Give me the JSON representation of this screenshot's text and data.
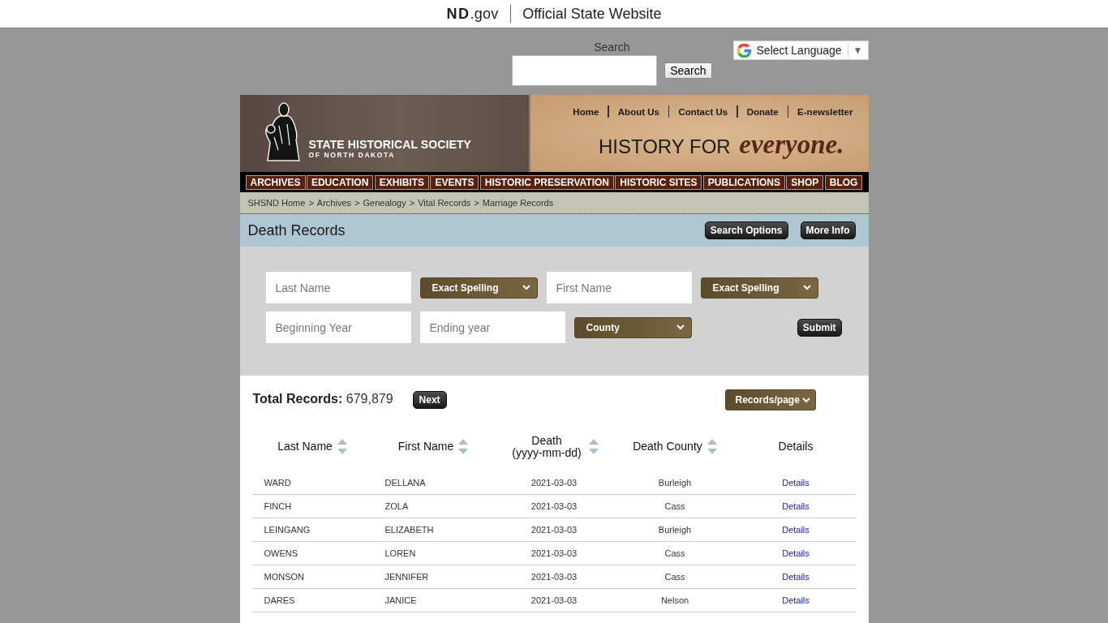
{
  "gov_bar": {
    "brand": "**ND**.gov",
    "tagline": "Official State Website"
  },
  "site_search": {
    "label": "Search",
    "button": "Search"
  },
  "language_select": {
    "label": "Select Language",
    "caret": "▼"
  },
  "header": {
    "logo_title": "STATE HISTORICAL SOCIETY",
    "logo_subtitle": "OF NORTH DAKOTA",
    "top_links": [
      "Home",
      "About Us",
      "Contact Us",
      "Donate",
      "E-newsletter"
    ],
    "slogan": "HISTORY FOR *everyone.*"
  },
  "main_nav": [
    "ARCHIVES",
    "EDUCATION",
    "EXHIBITS",
    "EVENTS",
    "HISTORIC PRESERVATION",
    "HISTORIC SITES",
    "PUBLICATIONS",
    "SHOP",
    "BLOG"
  ],
  "breadcrumb": {
    "separator": ">",
    "items": [
      "SHSND Home",
      "Archives",
      "Genealogy",
      "Vital Records",
      "Marriage Records"
    ]
  },
  "title_bar": {
    "title": "Death Records",
    "buttons": [
      "Search Options",
      "More Info"
    ]
  },
  "search_form": {
    "rows": [
      [
        {
          "kind": "input",
          "placeholder": "Last Name"
        },
        {
          "kind": "select",
          "value": "Exact Spelling"
        },
        {
          "kind": "input",
          "placeholder": "First Name"
        },
        {
          "kind": "select",
          "value": "Exact Spelling"
        }
      ],
      [
        {
          "kind": "input",
          "placeholder": "Beginning Year"
        },
        {
          "kind": "input",
          "placeholder": "Ending year"
        },
        {
          "kind": "select",
          "value": "County"
        },
        {
          "kind": "submit",
          "label": "Submit"
        }
      ]
    ]
  },
  "results": {
    "total": "**Total Records:** 679,879",
    "next": "Next",
    "per_page": "Records/page"
  },
  "table": {
    "columns": [
      {
        "label": "Last Name",
        "kind": "text",
        "sortable": true
      },
      {
        "label": "First Name",
        "kind": "text",
        "sortable": true
      },
      {
        "label": "Death (yyyy-mm-dd)",
        "kind": "text",
        "sortable": true
      },
      {
        "label": "Death County",
        "kind": "text",
        "sortable": true
      },
      {
        "label": "Details",
        "kind": "link",
        "sortable": false
      }
    ],
    "rows": [
      [
        "WARD",
        "DELLANA",
        "2021-03-03",
        "Burleigh",
        "Details"
      ],
      [
        "FINCH",
        "ZOLA",
        "2021-03-03",
        "Cass",
        "Details"
      ],
      [
        "LEINGANG",
        "ELIZABETH",
        "2021-03-03",
        "Burleigh",
        "Details"
      ],
      [
        "OWENS",
        "LOREN",
        "2021-03-03",
        "Cass",
        "Details"
      ],
      [
        "MONSON",
        "JENNIFER",
        "2021-03-03",
        "Cass",
        "Details"
      ],
      [
        "DARES",
        "JANICE",
        "2021-03-03",
        "Nelson",
        "Details"
      ]
    ]
  }
}
